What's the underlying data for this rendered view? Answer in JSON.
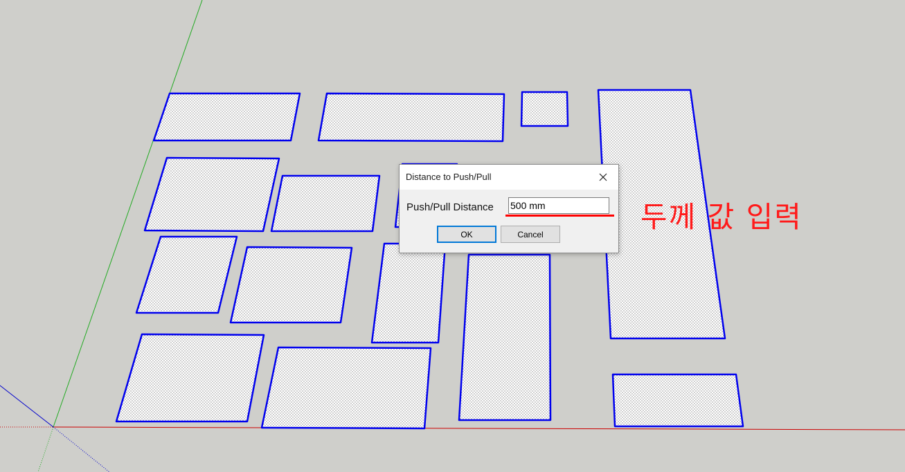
{
  "dialog": {
    "title": "Distance to Push/Pull",
    "field_label": "Push/Pull Distance",
    "field_value": "500 mm",
    "ok_label": "OK",
    "cancel_label": "Cancel"
  },
  "annotation": {
    "text": "두께 값 입력",
    "color": "#ff0000"
  },
  "colors": {
    "background": "#cfcfcb",
    "face_outline": "#0000ee",
    "red_axis": "#cc0000",
    "green_axis": "#22aa22",
    "blue_axis": "#0000cc"
  },
  "icons": [
    "close-icon"
  ]
}
